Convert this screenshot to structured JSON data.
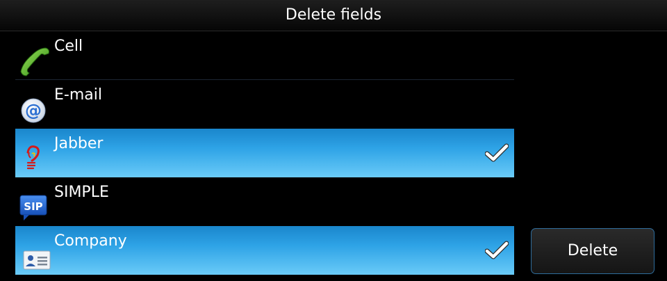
{
  "header": {
    "title": "Delete fields"
  },
  "fields": [
    {
      "label": "Cell",
      "icon": "phone-icon",
      "selected": false
    },
    {
      "label": "E-mail",
      "icon": "email-at-icon",
      "selected": false
    },
    {
      "label": "Jabber",
      "icon": "jabber-bulb-icon",
      "selected": true
    },
    {
      "label": "SIMPLE",
      "icon": "sip-icon",
      "selected": false
    },
    {
      "label": "Company",
      "icon": "business-card-icon",
      "selected": true
    }
  ],
  "sip_icon_text": "SIP",
  "actions": {
    "delete_label": "Delete"
  },
  "colors": {
    "selected_row": "#2ea3e6",
    "background": "#000000",
    "button_border": "#2f6d9c"
  }
}
